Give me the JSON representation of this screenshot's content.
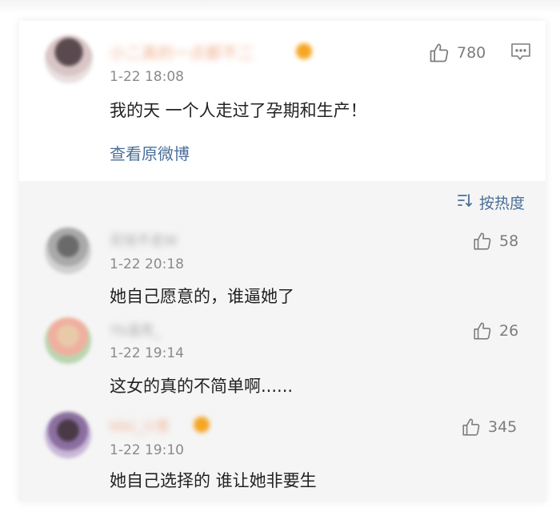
{
  "main_post": {
    "username": "小二真的一点都不二",
    "time": "1-22 18:08",
    "content": "我的天 一个人走过了孕期和生产！",
    "likes": "780",
    "view_original": "查看原微博"
  },
  "sort": {
    "label": "按热度"
  },
  "comments": [
    {
      "username": "花钱不走W",
      "time": "1-22 20:18",
      "content": "她自己愿意的，谁逼她了",
      "likes": "58"
    },
    {
      "username": "Yb温亮_",
      "time": "1-22 19:14",
      "content": "这女的真的不简单啊......",
      "likes": "26"
    },
    {
      "username": "Hiki_小雪",
      "time": "1-22 19:10",
      "content": "她自己选择的 谁让她非要生",
      "likes": "345"
    }
  ]
}
